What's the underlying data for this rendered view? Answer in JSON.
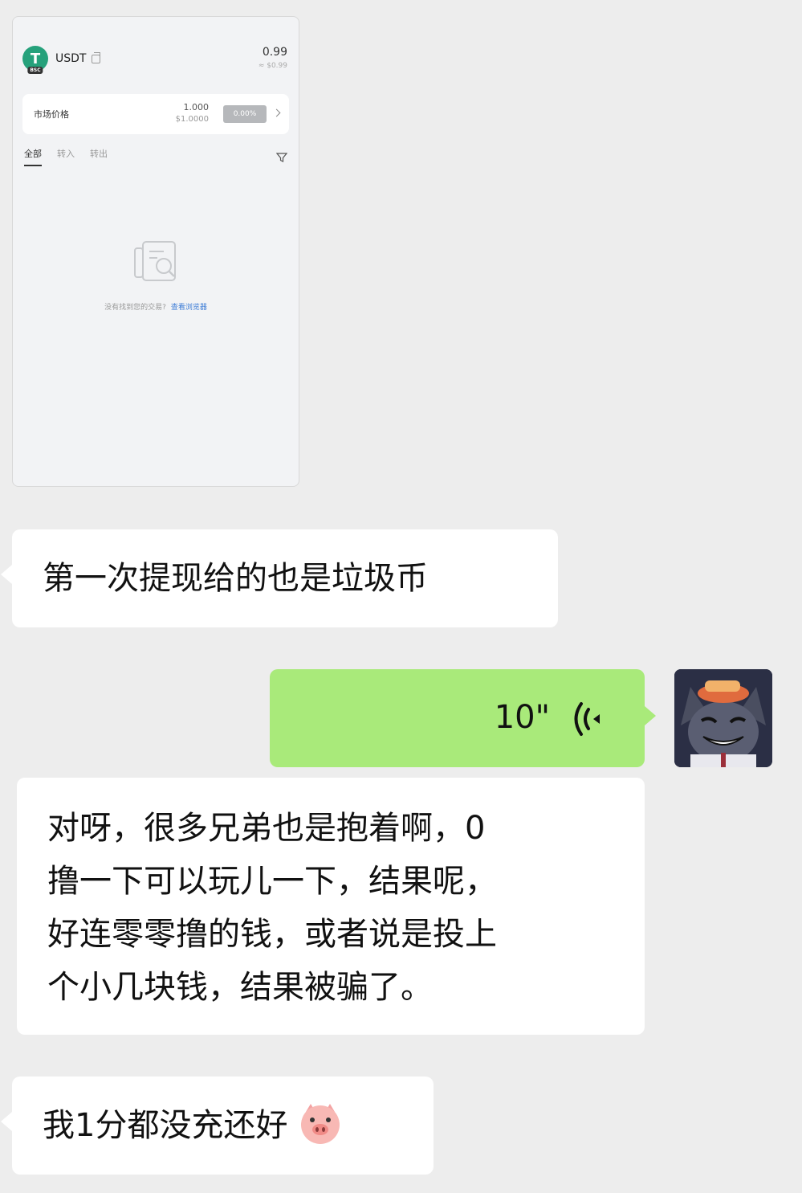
{
  "screenshot": {
    "token": {
      "logo_letter": "T",
      "chain_badge": "BSC",
      "name": "USDT",
      "balance": "0.99",
      "balance_usd": "≈ $0.99"
    },
    "market": {
      "label": "市场价格",
      "price": "1.000",
      "price_usd": "$1.0000",
      "change": "0.00%"
    },
    "tabs": [
      "全部",
      "转入",
      "转出"
    ],
    "empty_state": {
      "text": "没有找到您的交易?",
      "link": "查看浏览器"
    }
  },
  "messages": {
    "m1": "第一次提现给的也是垃圾币",
    "voice": {
      "duration": "10\""
    },
    "m3_lines": [
      "对呀，很多兄弟也是抱着啊，0",
      "撸一下可以玩儿一下，结果呢，",
      "好连零零撸的钱，或者说是投上",
      "个小几块钱，结果被骗了。"
    ],
    "m4": "我1分都没充还好"
  },
  "colors": {
    "background": "#ededed",
    "self_bubble": "#a9ea7a",
    "other_bubble": "#ffffff",
    "usdt_green": "#26a17b",
    "link_blue": "#3b7bd6"
  },
  "icons": {
    "voice": "voice-wave-icon",
    "filter": "filter-icon",
    "emoji": "pig-emoji"
  }
}
